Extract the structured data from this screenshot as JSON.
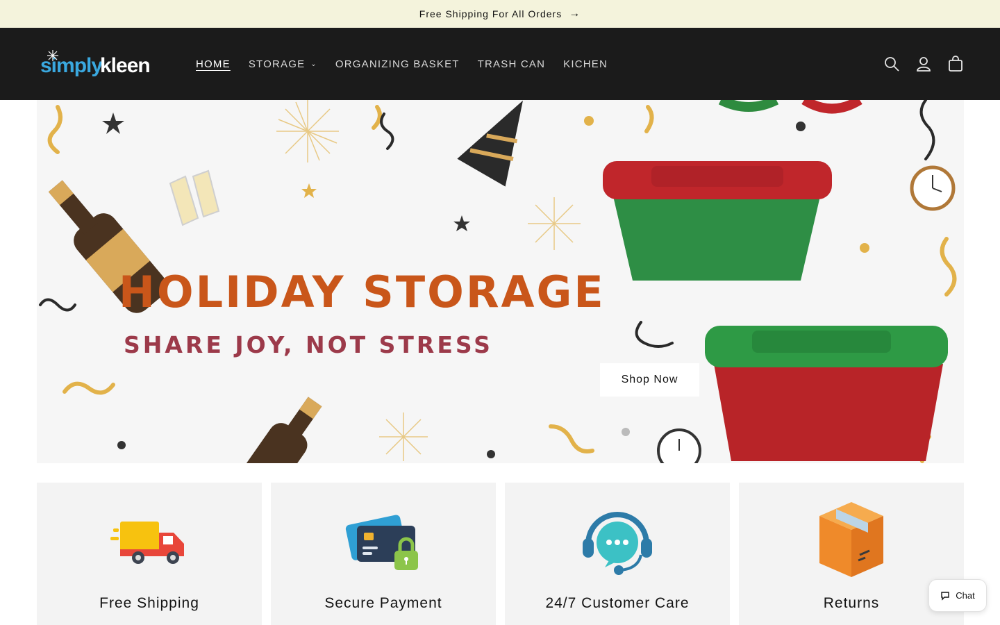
{
  "announcement": {
    "text": "Free Shipping For All Orders",
    "arrow_icon": "arrow-right-icon"
  },
  "header": {
    "logo_text": "simplykleen",
    "nav": [
      {
        "label": "HOME",
        "active": true
      },
      {
        "label": "STORAGE",
        "has_dropdown": true
      },
      {
        "label": "ORGANIZING BASKET"
      },
      {
        "label": "TRASH CAN"
      },
      {
        "label": "KICHEN"
      }
    ],
    "icons": [
      "search-icon",
      "account-icon",
      "cart-icon"
    ]
  },
  "hero": {
    "title": "HOLIDAY STORAGE",
    "subtitle": "SHARE JOY, NOT STRESS",
    "button_label": "Shop Now"
  },
  "features": [
    {
      "label": "Free Shipping",
      "icon": "truck-icon"
    },
    {
      "label": "Secure Payment",
      "icon": "credit-card-lock-icon"
    },
    {
      "label": "24/7 Customer Care",
      "icon": "headset-chat-icon"
    },
    {
      "label": "Returns",
      "icon": "box-icon"
    }
  ],
  "chat": {
    "label": "Chat"
  },
  "colors": {
    "header_bg": "#1b1b1b",
    "announce_bg": "#f4f3dc",
    "title_orange": "#c9561a",
    "subtitle_red": "#9c3a4a"
  }
}
